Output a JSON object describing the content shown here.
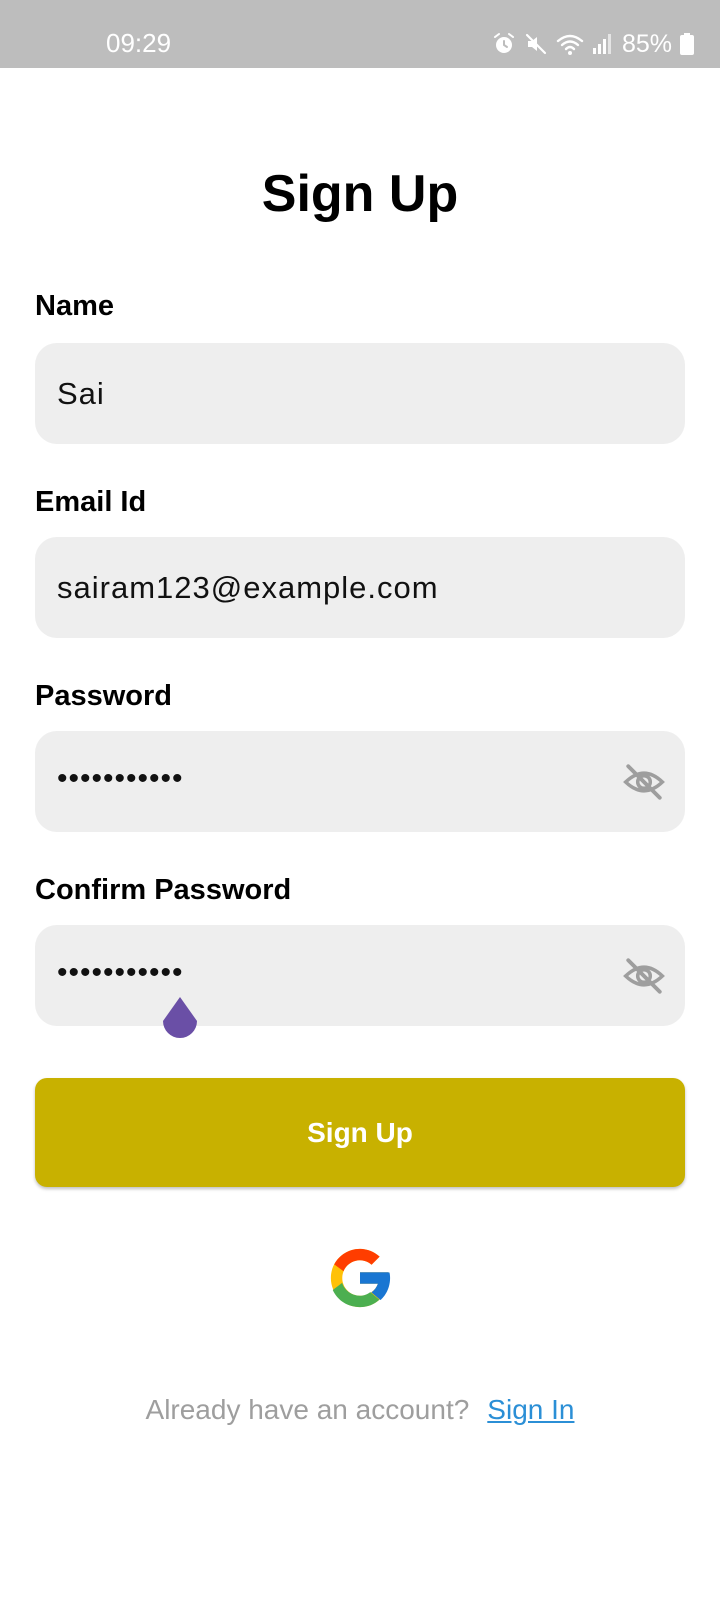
{
  "status_bar": {
    "time": "09:29",
    "battery": "85%",
    "icons": [
      "alarm-icon",
      "mute-icon",
      "wifi-icon",
      "signal-icon",
      "battery-icon"
    ]
  },
  "title": "Sign Up",
  "fields": {
    "name": {
      "label": "Name",
      "value": "Sai"
    },
    "email": {
      "label": "Email Id",
      "value": "sairam123@example.com"
    },
    "password": {
      "label": "Password",
      "value": "•••••••••••",
      "toggle_icon": "eye-off-icon"
    },
    "confirm_password": {
      "label": "Confirm Password",
      "value": "•••••••••••",
      "toggle_icon": "eye-off-icon"
    }
  },
  "signup_button": {
    "label": "Sign Up",
    "color": "#c8b100"
  },
  "google_icon": "google-icon",
  "footer": {
    "text": "Already have an account?",
    "link": "Sign In",
    "link_color": "#2b8fd6"
  },
  "colors": {
    "field_background": "#eeeeee",
    "status_bar": "#bdbdbd",
    "cursor_handle": "#6a4fa6"
  }
}
